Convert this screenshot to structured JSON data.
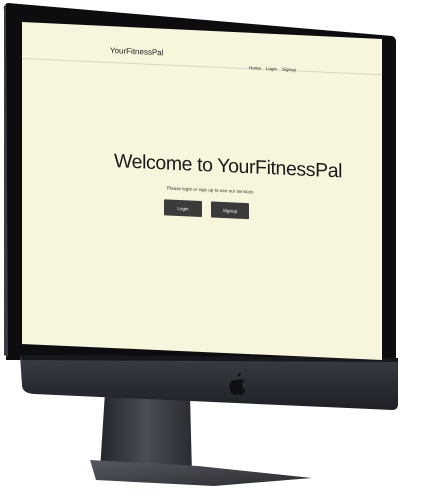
{
  "app": {
    "brand": "YourFitnessPal"
  },
  "nav": {
    "items": [
      "Home",
      "Login",
      "Signup"
    ]
  },
  "hero": {
    "title": "Welcome to YourFitnessPal",
    "subtitle": "Please login or sign up to use our services"
  },
  "actions": {
    "login_label": "Login",
    "signup_label": "Signup"
  },
  "colors": {
    "screen_background": "#f7f5db",
    "button_background": "#3b3b3b",
    "device_bezel": "#0c0c0e",
    "device_body": "#2b2d33"
  },
  "icons": {
    "device_logo": "apple-logo-icon"
  }
}
